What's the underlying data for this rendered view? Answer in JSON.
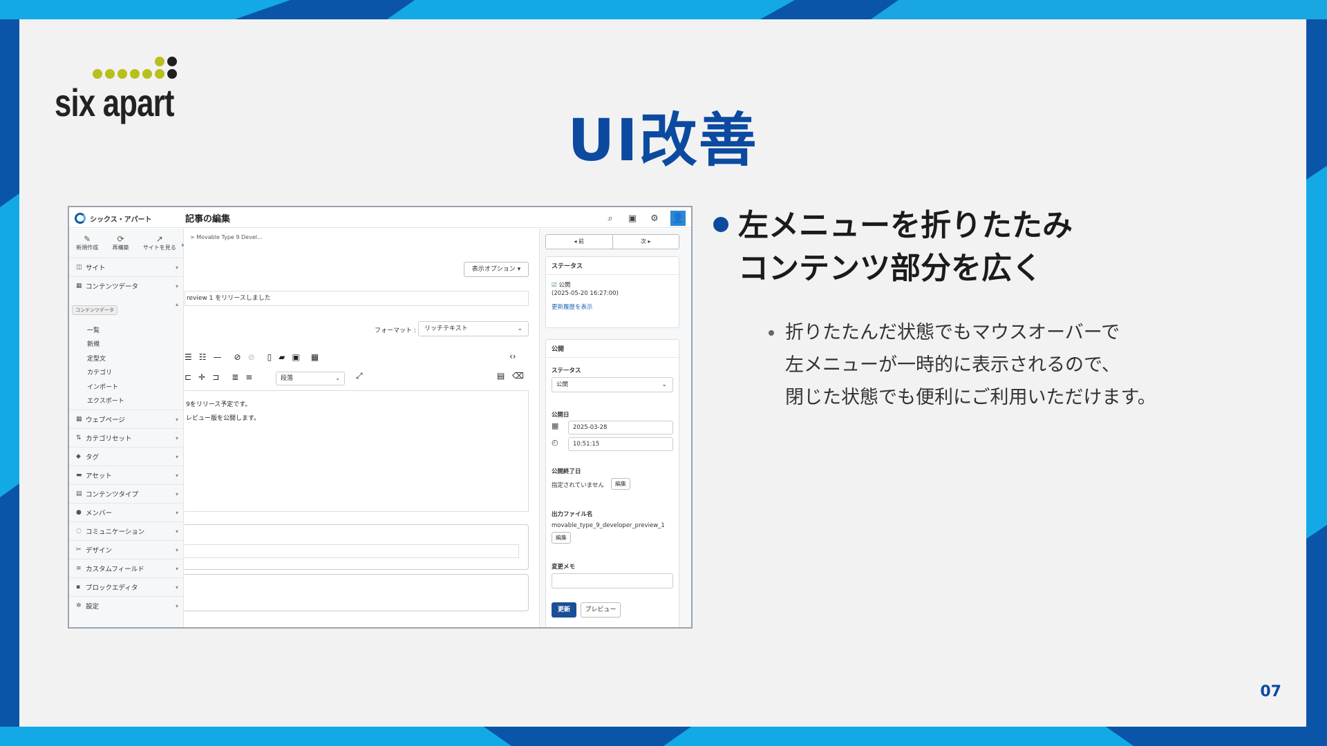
{
  "slide": {
    "title": "UI改善",
    "page_number": "07",
    "logo_text": "six apart",
    "colors": {
      "brand_blue": "#0c4aa0",
      "logo_green": "#b9bf1c",
      "background_blue": "#0a55a8"
    }
  },
  "bullets": {
    "main_line1": "左メニューを折りたたみ",
    "main_line2": "コンテンツ部分を広く",
    "sub_line1": "折りたたんだ状態でもマウスオーバーで",
    "sub_line2": "左メニューが一時的に表示されるので、",
    "sub_line3": "閉じた状態でも便利にご利用いただけます。"
  },
  "screenshot": {
    "header": {
      "site_name": "シックス・アパート",
      "page_title": "記事の編集"
    },
    "quick_actions": [
      {
        "icon": "wand-icon",
        "glyph": "✎",
        "label": "新規作成"
      },
      {
        "icon": "rebuild-icon",
        "glyph": "⟳",
        "label": "再構築"
      },
      {
        "icon": "external-icon",
        "glyph": "↗",
        "label": "サイトを見る"
      }
    ],
    "tooltip": "コンテンツデータ",
    "menu": [
      {
        "label": "サイト",
        "glyph": "◫"
      },
      {
        "label": "コンテンツデータ",
        "glyph": "▦"
      },
      {
        "label": "ウェブページ",
        "glyph": "▦"
      },
      {
        "label": "カテゴリセット",
        "glyph": "⇅"
      },
      {
        "label": "タグ",
        "glyph": "◆"
      },
      {
        "label": "アセット",
        "glyph": "▬"
      },
      {
        "label": "コンテンツタイプ",
        "glyph": "▤"
      },
      {
        "label": "メンバー",
        "glyph": "●"
      },
      {
        "label": "コミュニケーション",
        "glyph": "◌"
      },
      {
        "label": "デザイン",
        "glyph": "✂"
      },
      {
        "label": "カスタムフィールド",
        "glyph": "≡"
      },
      {
        "label": "ブロックエディタ",
        "glyph": "▪"
      },
      {
        "label": "設定",
        "glyph": "✲"
      }
    ],
    "submenu": [
      "一覧",
      "新規",
      "定型文",
      "カテゴリ",
      "インポート",
      "エクスポート"
    ],
    "content": {
      "breadcrumb": "> Movable Type 9 Devel...",
      "display_options": "表示オプション ▾",
      "title_value": "review 1 をリリースしました",
      "format_label": "フォーマット :",
      "format_value": "リッチテキスト",
      "paragraph_value": "段落",
      "body_line1": "9をリリース予定です。",
      "body_line2": "レビュー版を公開します。"
    },
    "right": {
      "prev": "◂ 前",
      "next": "次 ▸",
      "status_heading": "ステータス",
      "status_value": "公開",
      "status_date": "(2025-05-20 16:27:00)",
      "history_link": "更新履歴を表示",
      "publish_heading": "公開",
      "publish_status_label": "ステータス",
      "publish_status_value": "公開",
      "publish_date_label": "公開日",
      "publish_date": "2025-03-28",
      "publish_time": "10:51:15",
      "end_date_label": "公開終了日",
      "end_date_value": "指定されていません",
      "edit_button": "編集",
      "filename_label": "出力ファイル名",
      "filename_value": "movable_type_9_developer_preview_1",
      "memo_label": "変更メモ",
      "update_button": "更新",
      "preview_button": "プレビュー"
    }
  }
}
